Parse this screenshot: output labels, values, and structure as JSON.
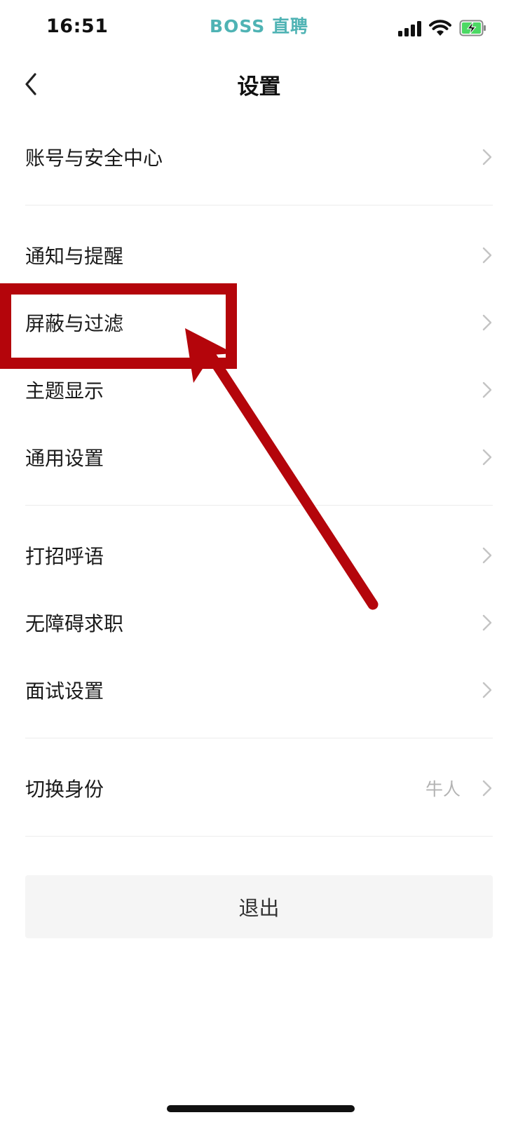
{
  "status": {
    "time": "16:51",
    "brand": "BOSS 直聘"
  },
  "nav": {
    "title": "设置"
  },
  "rows": [
    {
      "label": "账号与安全中心"
    },
    {
      "label": "通知与提醒"
    },
    {
      "label": "屏蔽与过滤"
    },
    {
      "label": "主题显示"
    },
    {
      "label": "通用设置"
    },
    {
      "label": "打招呼语"
    },
    {
      "label": "无障碍求职"
    },
    {
      "label": "面试设置"
    },
    {
      "label": "切换身份",
      "value": "牛人"
    }
  ],
  "logout": {
    "label": "退出"
  },
  "colors": {
    "brand": "#4fb3b4",
    "annotation": "#b4050b",
    "battery": "#4cd964"
  },
  "icons": [
    "back-chevron-icon",
    "chevron-right-icon",
    "signal-icon",
    "wifi-icon",
    "battery-charging-icon"
  ]
}
